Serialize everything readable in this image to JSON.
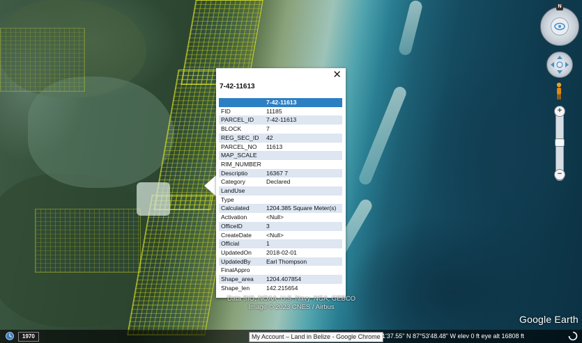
{
  "popup": {
    "title": "7-42-11613",
    "close_label": "✕",
    "header": "7-42-11613",
    "attributes": [
      {
        "key": "FID",
        "value": "11185"
      },
      {
        "key": "PARCEL_ID",
        "value": "7-42-11613"
      },
      {
        "key": "BLOCK",
        "value": "7"
      },
      {
        "key": "REG_SEC_ID",
        "value": "42"
      },
      {
        "key": "PARCEL_NO",
        "value": "11613"
      },
      {
        "key": "MAP_SCALE",
        "value": ""
      },
      {
        "key": "RIM_NUMBER",
        "value": ""
      },
      {
        "key": "Descriptio",
        "value": "16367 7"
      },
      {
        "key": "Category",
        "value": "Declared"
      },
      {
        "key": "LandUse",
        "value": ""
      },
      {
        "key": "Type",
        "value": ""
      },
      {
        "key": "Calculated",
        "value": "1204.385 Square Meter(s)"
      },
      {
        "key": "Activation",
        "value": "<Null>"
      },
      {
        "key": "OfficeID",
        "value": "3"
      },
      {
        "key": "CreateDate",
        "value": "<Null>"
      },
      {
        "key": "Official",
        "value": "1"
      },
      {
        "key": "UpdatedOn",
        "value": "2018-02-01"
      },
      {
        "key": "UpdatedBy",
        "value": "Earl Thompson"
      },
      {
        "key": "FinalAppro",
        "value": ""
      },
      {
        "key": "Shape_area",
        "value": "1204.407854"
      },
      {
        "key": "Shape_len",
        "value": "142.215654"
      }
    ]
  },
  "navigation": {
    "compass_label": "N",
    "zoom_in_label": "+",
    "zoom_out_label": "−",
    "icons": [
      "compass-icon",
      "look-joystick-icon",
      "move-joystick-icon",
      "pegman-icon",
      "zoom-slider"
    ]
  },
  "attribution": {
    "line1": "Data SIO, NOAA, U.S. Navy, NGA, GEBCO",
    "line2": "Image © 2023 CNES / Airbus"
  },
  "logo": "Google Earth",
  "status": {
    "year": "1970",
    "window_tooltip": "My Account – Land in Belize - Google Chrome",
    "coordinates": "1'37.55\" N   87°53'48.48\" W   elev       0 ft     eye alt  16808 ft"
  },
  "colors": {
    "parcel_outline": "#d2dc28",
    "table_header": "#2d7fc4",
    "table_stripe": "#dde6f1"
  }
}
